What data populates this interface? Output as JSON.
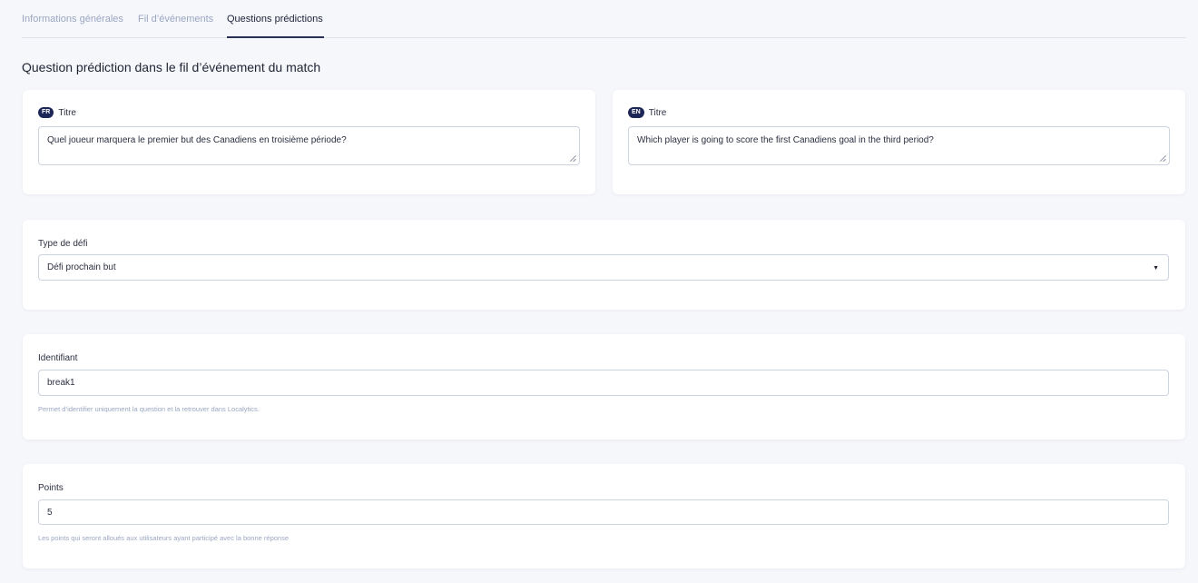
{
  "tabs": [
    {
      "label": "Informations générales",
      "active": false
    },
    {
      "label": "Fil d’événements",
      "active": false
    },
    {
      "label": "Questions prédictions",
      "active": true
    }
  ],
  "section_title": "Question prédiction dans le fil d’événement du match",
  "title_fr": {
    "badge": "FR",
    "label": "Titre",
    "value": "Quel joueur marquera le premier but des Canadiens en troisième période?"
  },
  "title_en": {
    "badge": "EN",
    "label": "Titre",
    "value": "Which player is going to score the first Canadiens goal in the third period?"
  },
  "challenge_type": {
    "label": "Type de défi",
    "value": "Défi prochain but"
  },
  "identifier": {
    "label": "Identifiant",
    "value": "break1",
    "help": "Permet d’identifier uniquement la question et la retrouver dans Localytics."
  },
  "points": {
    "label": "Points",
    "value": "5",
    "help": "Les points qui seront alloués aux utilisateurs ayant participé avec la bonne réponse"
  },
  "colors": {
    "background": "#f6f7fb",
    "badge": "#1b2556",
    "muted_text": "#9aa6c2",
    "active_tab_underline": "#2a2f55"
  }
}
